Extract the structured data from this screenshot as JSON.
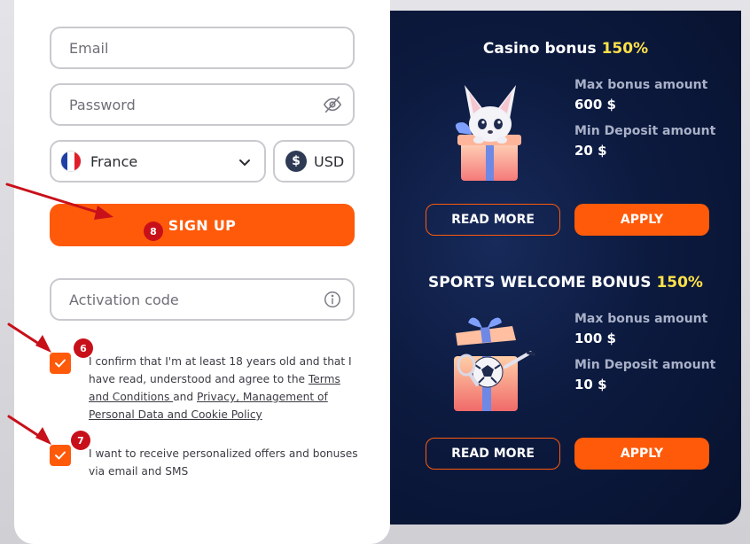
{
  "form": {
    "email_placeholder": "Email",
    "password_placeholder": "Password",
    "country": "France",
    "currency_symbol": "$",
    "currency": "USD",
    "signup_label": "SIGN UP",
    "activation_placeholder": "Activation code",
    "consent_age": {
      "prefix": "I confirm that I'm at least 18 years old and that I have read, understood and agree to the ",
      "terms_link": "Terms and Conditions ",
      "middle": "and ",
      "privacy_link": "Privacy, Management of Personal Data and Cookie Policy"
    },
    "consent_marketing": "I want to receive personalized offers and bonuses via email and SMS"
  },
  "annotations": {
    "signup_step": "8",
    "age_step": "6",
    "marketing_step": "7"
  },
  "bonuses": [
    {
      "title": "Casino bonus ",
      "percent": "150%",
      "max_label": "Max bonus amount",
      "max_value": "600 $",
      "min_label": "Min Deposit amount",
      "min_value": "20 $",
      "read_more": "READ MORE",
      "apply": "APPLY"
    },
    {
      "title": "SPORTS WELCOME BONUS ",
      "percent": "150%",
      "max_label": "Max bonus amount",
      "max_value": "100 $",
      "min_label": "Min Deposit amount",
      "min_value": "10 $",
      "read_more": "READ MORE",
      "apply": "APPLY"
    }
  ],
  "colors": {
    "accent": "#ff5a0a",
    "panel_dark": "#0c1a3f",
    "highlight": "#ffe14a",
    "badge": "#c8101a"
  }
}
